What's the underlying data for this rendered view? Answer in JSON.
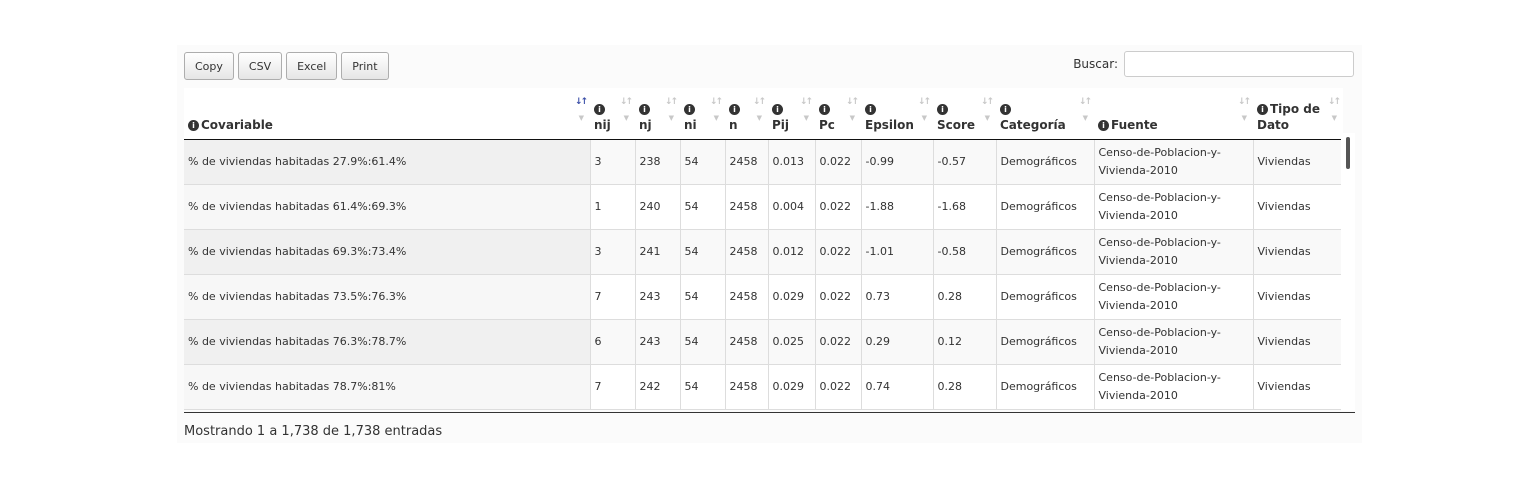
{
  "toolbar": {
    "copy_label": "Copy",
    "csv_label": "CSV",
    "excel_label": "Excel",
    "print_label": "Print"
  },
  "search": {
    "label": "Buscar:",
    "value": "",
    "placeholder": ""
  },
  "table": {
    "columns": [
      {
        "label": "Covariable",
        "label2": "",
        "sort": "active"
      },
      {
        "label": "",
        "label2": "nij",
        "sort": ""
      },
      {
        "label": "",
        "label2": "nj",
        "sort": ""
      },
      {
        "label": "",
        "label2": "ni",
        "sort": ""
      },
      {
        "label": "",
        "label2": "n",
        "sort": ""
      },
      {
        "label": "",
        "label2": "Pij",
        "sort": ""
      },
      {
        "label": "",
        "label2": "Pc",
        "sort": ""
      },
      {
        "label": "",
        "label2": "Epsilon",
        "sort": ""
      },
      {
        "label": "",
        "label2": "Score",
        "sort": ""
      },
      {
        "label": "",
        "label2": "Categoría",
        "sort": ""
      },
      {
        "label": "Fuente",
        "label2": "",
        "sort": ""
      },
      {
        "label": "Tipo de",
        "label2": "Dato",
        "sort": ""
      }
    ],
    "rows": [
      [
        "% de viviendas habitadas 27.9%:61.4%",
        "3",
        "238",
        "54",
        "2458",
        "0.013",
        "0.022",
        "-0.99",
        "-0.57",
        "Demográficos",
        "Censo-de-Poblacion-y-Vivienda-2010",
        "Viviendas"
      ],
      [
        "% de viviendas habitadas 61.4%:69.3%",
        "1",
        "240",
        "54",
        "2458",
        "0.004",
        "0.022",
        "-1.88",
        "-1.68",
        "Demográficos",
        "Censo-de-Poblacion-y-Vivienda-2010",
        "Viviendas"
      ],
      [
        "% de viviendas habitadas 69.3%:73.4%",
        "3",
        "241",
        "54",
        "2458",
        "0.012",
        "0.022",
        "-1.01",
        "-0.58",
        "Demográficos",
        "Censo-de-Poblacion-y-Vivienda-2010",
        "Viviendas"
      ],
      [
        "% de viviendas habitadas 73.5%:76.3%",
        "7",
        "243",
        "54",
        "2458",
        "0.029",
        "0.022",
        "0.73",
        "0.28",
        "Demográficos",
        "Censo-de-Poblacion-y-Vivienda-2010",
        "Viviendas"
      ],
      [
        "% de viviendas habitadas 76.3%:78.7%",
        "6",
        "243",
        "54",
        "2458",
        "0.025",
        "0.022",
        "0.29",
        "0.12",
        "Demográficos",
        "Censo-de-Poblacion-y-Vivienda-2010",
        "Viviendas"
      ],
      [
        "% de viviendas habitadas 78.7%:81%",
        "7",
        "242",
        "54",
        "2458",
        "0.029",
        "0.022",
        "0.74",
        "0.28",
        "Demográficos",
        "Censo-de-Poblacion-y-Vivienda-2010",
        "Viviendas"
      ]
    ]
  },
  "footer": {
    "info": "Mostrando 1 a 1,738 de 1,738 entradas"
  }
}
